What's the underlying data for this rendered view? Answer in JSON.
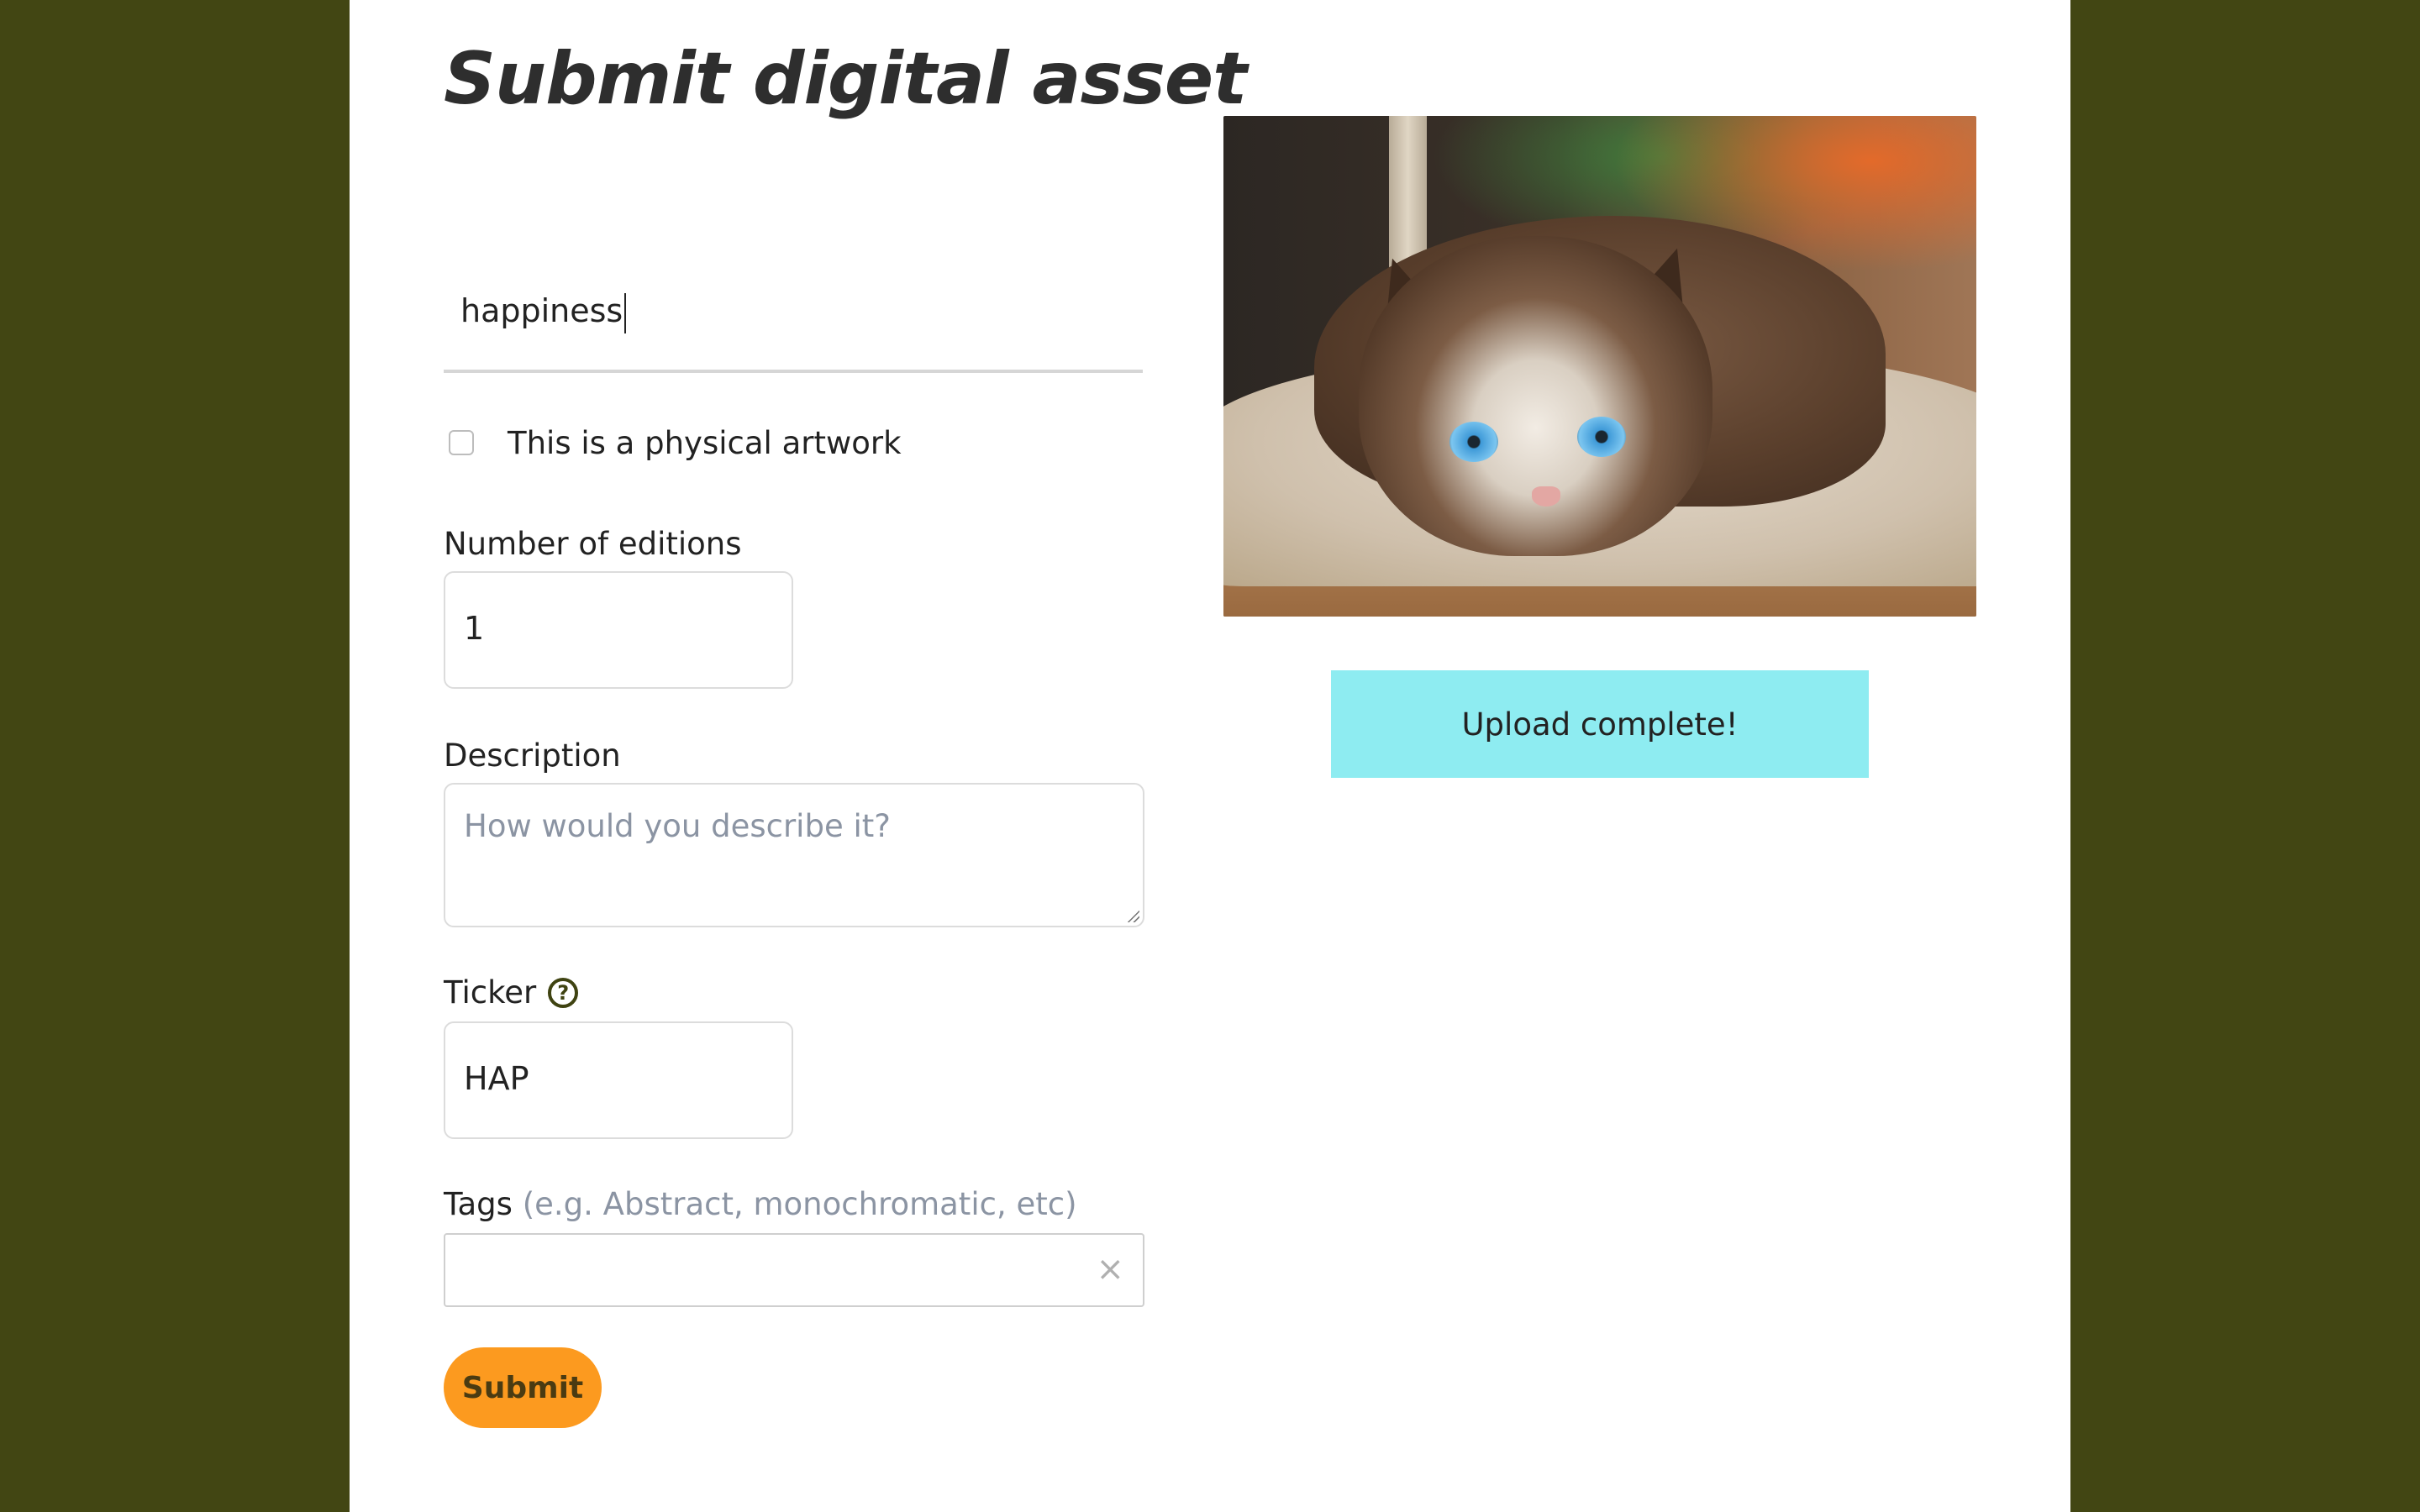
{
  "title": "Submit digital asset",
  "form": {
    "name_value": "happiness",
    "physical_checkbox": {
      "label": "This is a physical artwork",
      "checked": false
    },
    "editions": {
      "label": "Number of editions",
      "value": "1"
    },
    "description": {
      "label": "Description",
      "placeholder": "How would you describe it?",
      "value": ""
    },
    "ticker": {
      "label": "Ticker",
      "value": "HAP",
      "help_icon": "question-circle-icon"
    },
    "tags": {
      "label": "Tags",
      "hint": "(e.g. Abstract, monochromatic, etc)",
      "clear_symbol": "×",
      "clear_icon": "close-icon"
    },
    "submit_label": "Submit"
  },
  "preview": {
    "subject": "cat",
    "upload_status": "Upload complete!"
  },
  "colors": {
    "background": "#424613",
    "panel": "#ffffff",
    "submit": "#fc9a1f",
    "upload_banner": "#8eecf1",
    "help_icon": "#3f4311"
  }
}
